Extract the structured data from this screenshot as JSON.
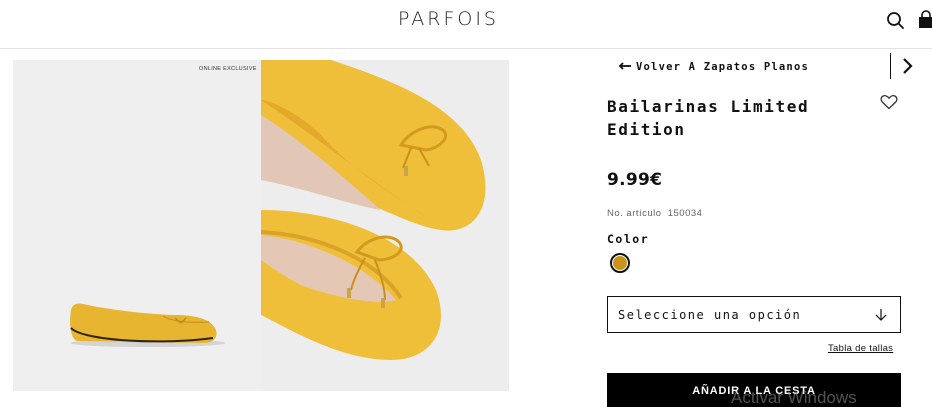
{
  "brand": {
    "logo_text": "PARFOIS"
  },
  "header": {
    "search_icon": "search-icon",
    "bag_icon": "shopping-bag-icon"
  },
  "gallery": {
    "badge": "ONLINE EXCLUSIVE",
    "images": [
      {
        "alt": "Bailarinas Limited Edition side view",
        "shoe_color": "#e5b22e"
      },
      {
        "alt": "Bailarinas Limited Edition close-up",
        "shoe_color": "#e5b22e"
      }
    ]
  },
  "product": {
    "back_link": "Volver A Zapatos Planos",
    "title": "Bailarinas Limited Edition",
    "price": "9.99€",
    "ref_label": "No. artículo",
    "ref_value": "150034",
    "color_label": "Color",
    "color_swatch": "#c8941b",
    "size_placeholder": "Seleccione una opción",
    "size_guide": "Tabla de tallas",
    "add_to_cart": "AÑADIR A LA CESTA"
  },
  "overlay": {
    "watermark": "Activar Windows"
  }
}
